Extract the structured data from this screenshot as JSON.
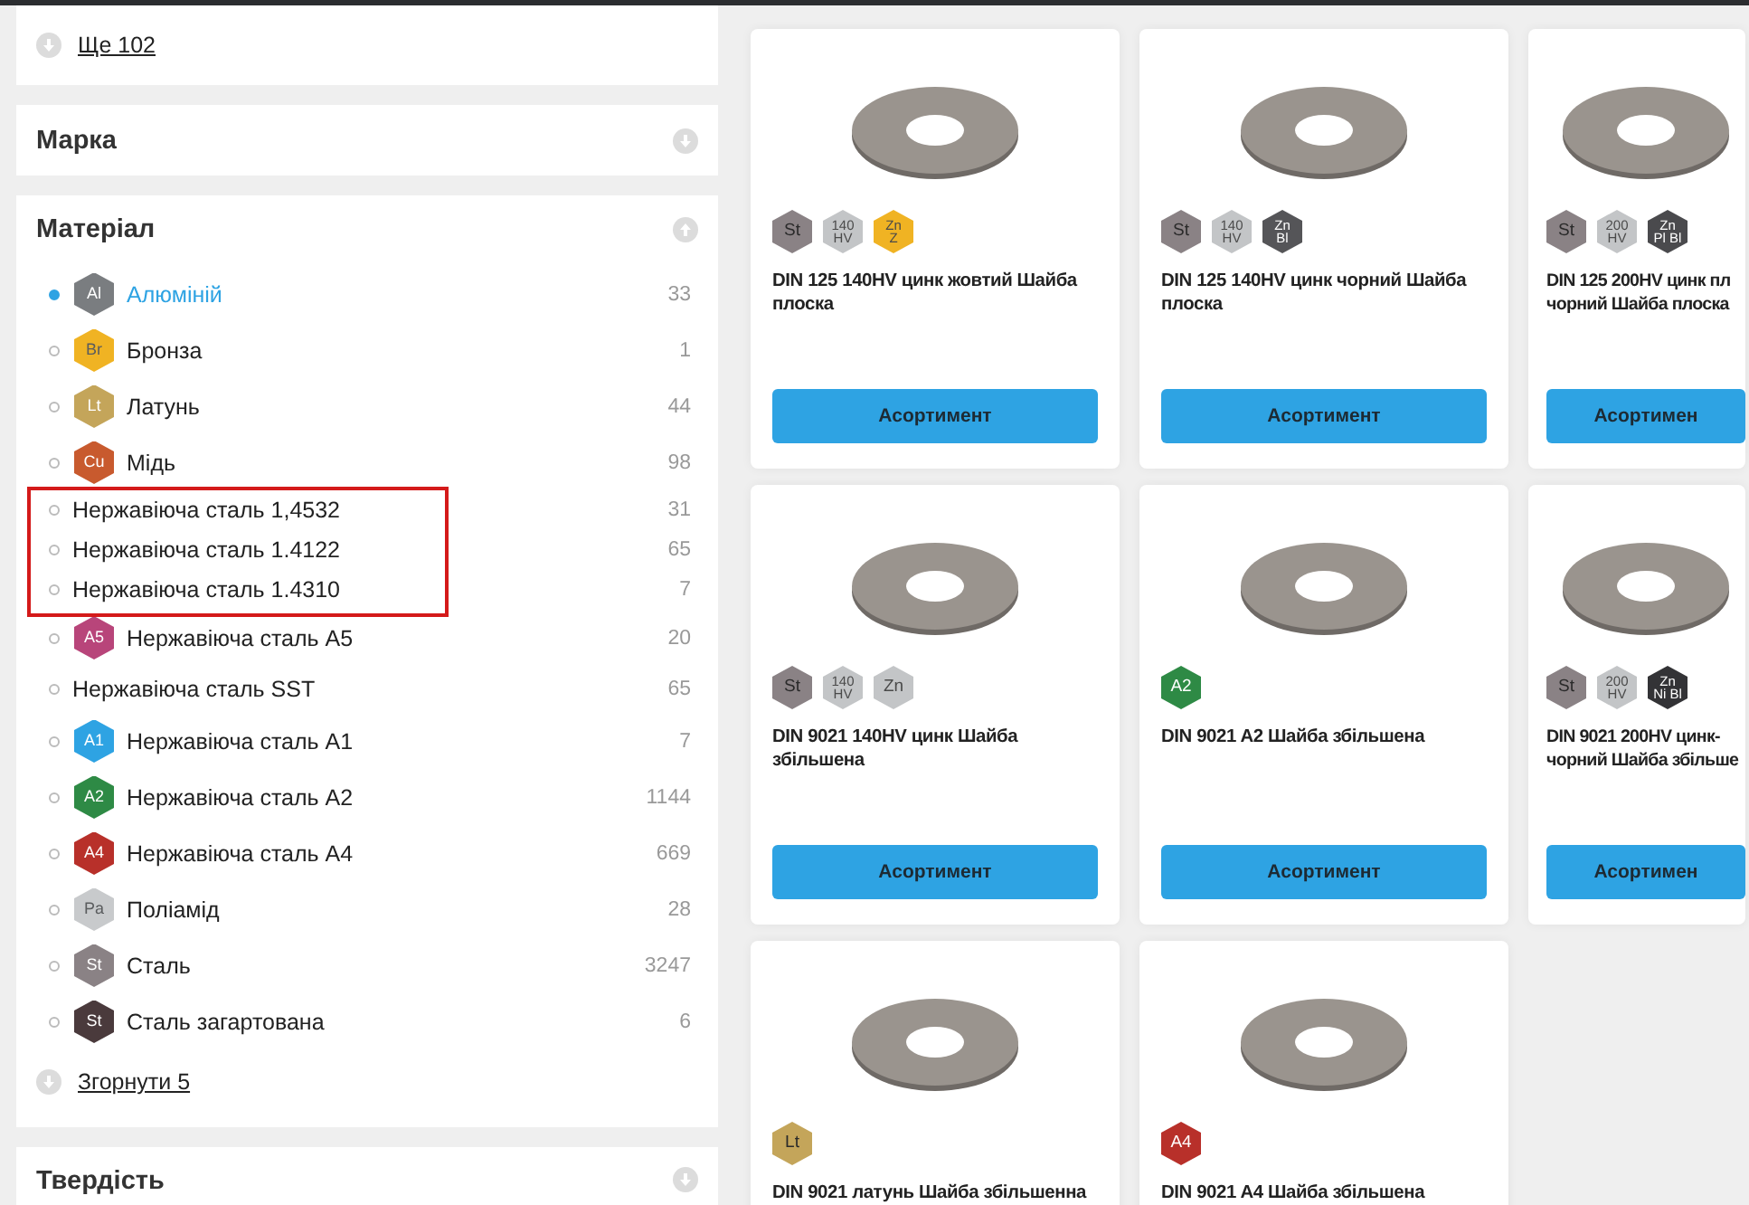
{
  "sidebar": {
    "more_link": "Ще 102",
    "sections": [
      {
        "title": "Марка",
        "expanded": false
      },
      {
        "title": "Матеріал",
        "expanded": true,
        "collapse_link": "Згорнути 5",
        "items": [
          {
            "label": "Алюміній",
            "count": "33",
            "selected": true,
            "highlighted": false,
            "badge": {
              "lines": [
                "Al"
              ],
              "color": "#7a7d80"
            }
          },
          {
            "label": "Бронза",
            "count": "1",
            "selected": false,
            "highlighted": false,
            "badge": {
              "lines": [
                "Br"
              ],
              "color": "#f0b323"
            }
          },
          {
            "label": "Латунь",
            "count": "44",
            "selected": false,
            "highlighted": false,
            "badge": {
              "lines": [
                "Lt"
              ],
              "color": "#c4a55a"
            }
          },
          {
            "label": "Мідь",
            "count": "98",
            "selected": false,
            "highlighted": false,
            "badge": {
              "lines": [
                "Cu"
              ],
              "color": "#c85a2e"
            }
          },
          {
            "label": "Нержавіюча сталь 1,4532",
            "count": "31",
            "selected": false,
            "highlighted": true
          },
          {
            "label": "Нержавіюча сталь 1.4122",
            "count": "65",
            "selected": false,
            "highlighted": true
          },
          {
            "label": "Нержавіюча сталь 1.4310",
            "count": "7",
            "selected": false,
            "highlighted": true
          },
          {
            "label": "Нержавіюча сталь A5",
            "count": "20",
            "selected": false,
            "highlighted": false,
            "badge": {
              "lines": [
                "A5"
              ],
              "color": "#b8457a"
            }
          },
          {
            "label": "Нержавіюча сталь SST",
            "count": "65",
            "selected": false,
            "highlighted": false
          },
          {
            "label": "Нержавіюча сталь A1",
            "count": "7",
            "selected": false,
            "highlighted": false,
            "badge": {
              "lines": [
                "A1"
              ],
              "color": "#2ea3e3"
            }
          },
          {
            "label": "Нержавіюча сталь A2",
            "count": "1144",
            "selected": false,
            "highlighted": false,
            "badge": {
              "lines": [
                "A2"
              ],
              "color": "#2e8a45"
            }
          },
          {
            "label": "Нержавіюча сталь A4",
            "count": "669",
            "selected": false,
            "highlighted": false,
            "badge": {
              "lines": [
                "A4"
              ],
              "color": "#b8302a"
            }
          },
          {
            "label": "Поліамід",
            "count": "28",
            "selected": false,
            "highlighted": false,
            "badge": {
              "lines": [
                "Pa"
              ],
              "color": "#c8cacc"
            }
          },
          {
            "label": "Сталь",
            "count": "3247",
            "selected": false,
            "highlighted": false,
            "badge": {
              "lines": [
                "St"
              ],
              "color": "#8a8285"
            }
          },
          {
            "label": "Сталь загартована",
            "count": "6",
            "selected": false,
            "highlighted": false,
            "badge": {
              "lines": [
                "St"
              ],
              "color": "#4a3a3c"
            }
          }
        ]
      },
      {
        "title": "Твердість",
        "expanded": false
      }
    ]
  },
  "products": [
    {
      "title": "DIN 125 140HV цинк жовтий Шайба плоска",
      "button": "Асортимент",
      "badges": [
        {
          "lines": [
            "St"
          ],
          "color": "#8a8285"
        },
        {
          "lines": [
            "140",
            "HV"
          ],
          "color": "#c3c5c7"
        },
        {
          "lines": [
            "Zn",
            "Z"
          ],
          "color": "#f0b323"
        }
      ]
    },
    {
      "title": "DIN 125 140HV цинк чорний Шайба плоска",
      "button": "Асортимент",
      "badges": [
        {
          "lines": [
            "St"
          ],
          "color": "#8a8285"
        },
        {
          "lines": [
            "140",
            "HV"
          ],
          "color": "#c3c5c7"
        },
        {
          "lines": [
            "Zn",
            "Bl"
          ],
          "color": "#555558"
        }
      ]
    },
    {
      "title": "DIN 125 200HV цинк пл\nчорний Шайба плоска",
      "button": "Асортимен",
      "badges": [
        {
          "lines": [
            "St"
          ],
          "color": "#8a8285"
        },
        {
          "lines": [
            "200",
            "HV"
          ],
          "color": "#c3c5c7"
        },
        {
          "lines": [
            "Zn",
            "Pl Bl"
          ],
          "color": "#4a4a4d"
        }
      ]
    },
    {
      "title": "DIN 9021 140HV цинк Шайба збільшена",
      "button": "Асортимент",
      "badges": [
        {
          "lines": [
            "St"
          ],
          "color": "#8a8285"
        },
        {
          "lines": [
            "140",
            "HV"
          ],
          "color": "#c3c5c7"
        },
        {
          "lines": [
            "Zn"
          ],
          "color": "#c3c5c7"
        }
      ]
    },
    {
      "title": "DIN 9021 A2 Шайба збільшена",
      "button": "Асортимент",
      "badges": [
        {
          "lines": [
            "A2"
          ],
          "color": "#2e8a45"
        }
      ]
    },
    {
      "title": "DIN 9021 200HV цинк-\nчорний Шайба збільше",
      "button": "Асортимен",
      "badges": [
        {
          "lines": [
            "St"
          ],
          "color": "#8a8285"
        },
        {
          "lines": [
            "200",
            "HV"
          ],
          "color": "#c3c5c7"
        },
        {
          "lines": [
            "Zn",
            "Ni Bl"
          ],
          "color": "#333336"
        }
      ]
    },
    {
      "title": "DIN 9021 латунь Шайба збільшенна",
      "badges": [
        {
          "lines": [
            "Lt"
          ],
          "color": "#c4a55a"
        }
      ]
    },
    {
      "title": "DIN 9021 A4 Шайба збільшена",
      "badges": [
        {
          "lines": [
            "A4"
          ],
          "color": "#b8302a"
        }
      ]
    }
  ]
}
